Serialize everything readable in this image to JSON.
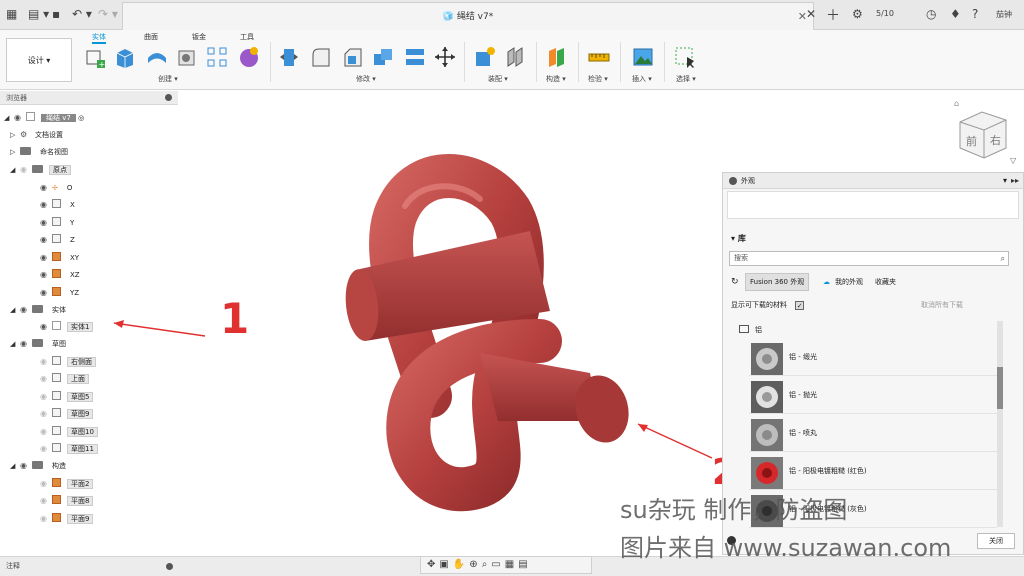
{
  "titlebar": {
    "doc_title": "🧊 绳结 v7*",
    "counter": "5/10",
    "user": "茄钟"
  },
  "toolbar": {
    "workspace": "设计 ▾",
    "tabs": [
      "实体",
      "曲面",
      "钣金",
      "工具"
    ],
    "groups": [
      "创建 ▾",
      "修改 ▾",
      "装配 ▾",
      "构造 ▾",
      "检验 ▾",
      "插入 ▾",
      "选择 ▾"
    ]
  },
  "browser": {
    "title": "浏览器",
    "root": "绳结 v7",
    "doc_settings": "文档设置",
    "named_views": "命名视图",
    "origin": "原点",
    "origin_items": [
      "O",
      "X",
      "Y",
      "Z",
      "XY",
      "XZ",
      "YZ"
    ],
    "bodies": "实体",
    "body1": "实体1",
    "sketches": "草图",
    "sketch_items": [
      "右侧面",
      "上面",
      "草图5",
      "草图9",
      "草图10",
      "草图11"
    ],
    "construction": "构造",
    "planes": [
      "平面2",
      "平面8",
      "平面9"
    ]
  },
  "annotations": {
    "one": "1",
    "two": "2"
  },
  "appearance_panel": {
    "title": "外观",
    "library": "库",
    "search_placeholder": "搜索",
    "tab_fusion": "Fusion 360 外观",
    "tab_mine": "我的外观",
    "tab_fav": "收藏夹",
    "show_download": "显示可下载的材料",
    "cancel_download": "取消所有下载",
    "folder": "铝",
    "materials": [
      "铝 - 缎光",
      "铝 - 抛光",
      "铝 - 喷丸",
      "铝 - 阳极电镀粗糙 (红色)",
      "铝 - 阳极电镀粗糙 (灰色)"
    ],
    "close": "关闭"
  },
  "status": {
    "history": "注释"
  },
  "watermark": {
    "line1": "su杂玩 制作，防盗图",
    "line2": "图片来自 www.suzawan.com"
  },
  "viewcube": {
    "front": "前",
    "right": "右"
  },
  "colors": {
    "model": "#b5403e",
    "accent": "#0696d7",
    "annotation": "#e03030"
  }
}
